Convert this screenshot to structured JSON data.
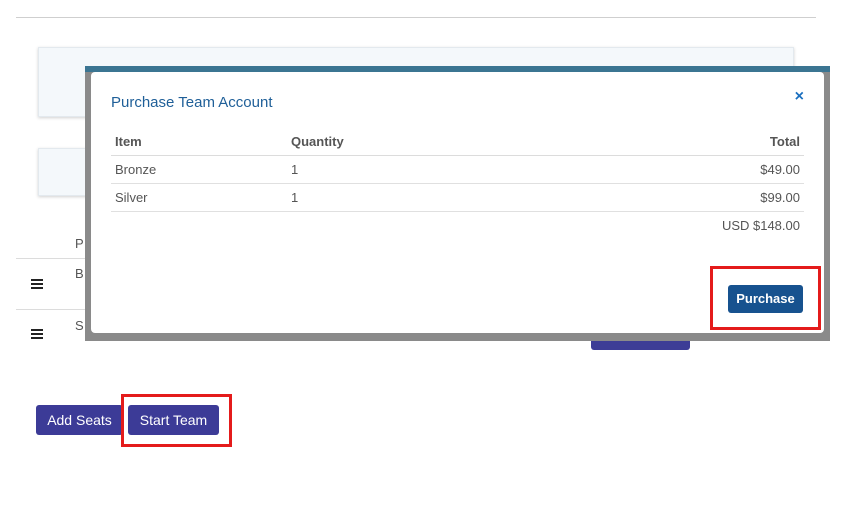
{
  "background": {
    "column_header_letter": "P",
    "rows": [
      {
        "letter": "B"
      },
      {
        "letter": "S"
      }
    ]
  },
  "actions": {
    "add_seats_label": "Add Seats",
    "start_team_label": "Start Team"
  },
  "modal": {
    "title": "Purchase Team Account",
    "close_glyph": "×",
    "columns": [
      "Item",
      "Quantity",
      "Total"
    ],
    "rows": [
      {
        "item": "Bronze",
        "quantity": "1",
        "total": "$49.00"
      },
      {
        "item": "Silver",
        "quantity": "1",
        "total": "$99.00"
      }
    ],
    "grand_total": "USD $148.00",
    "purchase_label": "Purchase"
  },
  "colors": {
    "primary_button": "#3c3b97",
    "purchase_button": "#17528f",
    "title_blue": "#1f5f98",
    "highlight_red": "#e41b1b"
  },
  "icons": {
    "row_menu": "hamburger-icon",
    "modal_close": "close-icon"
  }
}
